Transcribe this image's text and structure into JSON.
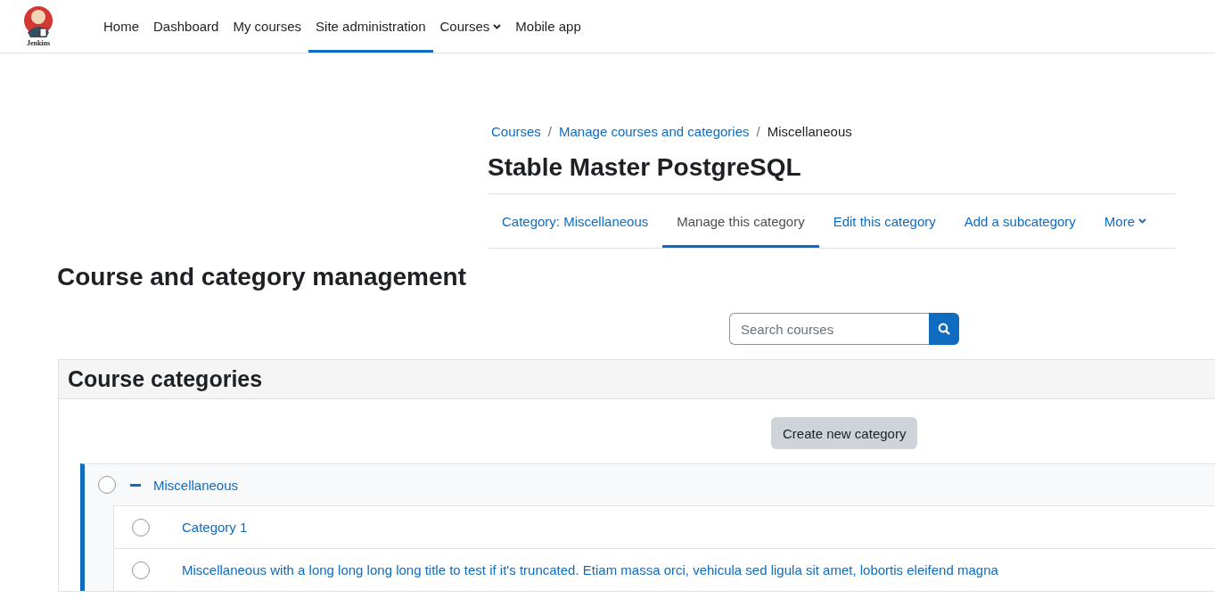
{
  "logo": {
    "text": "Jenkins"
  },
  "nav": [
    {
      "label": "Home",
      "selected": false,
      "dropdown": false
    },
    {
      "label": "Dashboard",
      "selected": false,
      "dropdown": false
    },
    {
      "label": "My courses",
      "selected": false,
      "dropdown": false
    },
    {
      "label": "Site administration",
      "selected": true,
      "dropdown": false
    },
    {
      "label": "Courses",
      "selected": false,
      "dropdown": true
    },
    {
      "label": "Mobile app",
      "selected": false,
      "dropdown": false
    }
  ],
  "breadcrumb": [
    {
      "label": "Courses",
      "link": true
    },
    {
      "separator": "/",
      "label": "Manage courses and categories",
      "link": true
    },
    {
      "separator": "/",
      "label": "Miscellaneous",
      "link": false
    }
  ],
  "page_title": "Stable Master PostgreSQL",
  "secondary_nav": [
    {
      "label": "Category: Miscellaneous",
      "selected": false,
      "dropdown": false
    },
    {
      "label": "Manage this category",
      "selected": true,
      "dropdown": false
    },
    {
      "label": "Edit this category",
      "selected": false,
      "dropdown": false
    },
    {
      "label": "Add a subcategory",
      "selected": false,
      "dropdown": false
    },
    {
      "label": "More",
      "selected": false,
      "dropdown": true
    }
  ],
  "heading": "Course and category management",
  "search": {
    "placeholder": "Search courses"
  },
  "categories_panel": {
    "title": "Course categories",
    "create_button": "Create new category",
    "items": [
      {
        "name": "Miscellaneous",
        "checked": false,
        "expanded": true,
        "children": [
          {
            "name": "Category 1",
            "checked": false
          },
          {
            "name": "Miscellaneous with a long long long long title to test if it's truncated. Etiam massa orci, vehicula sed ligula sit amet, lobortis eleifend magna",
            "checked": false
          }
        ]
      }
    ]
  }
}
